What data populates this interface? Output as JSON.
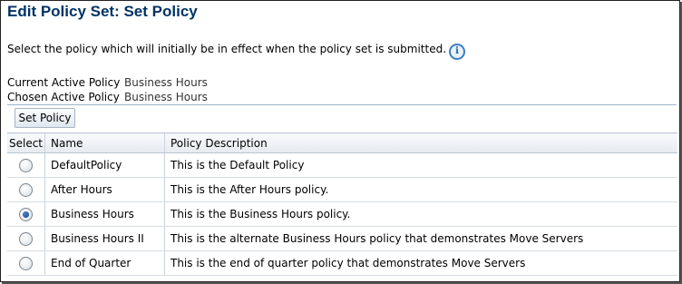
{
  "page": {
    "title": "Edit Policy Set: Set Policy",
    "instruction": "Select the policy which will initially be in effect when the policy set is submitted."
  },
  "status": {
    "current_label": "Current Active Policy",
    "current_value": "Business Hours",
    "chosen_label": "Chosen Active Policy",
    "chosen_value": "Business Hours"
  },
  "toolbar": {
    "set_policy_label": "Set Policy"
  },
  "table": {
    "headers": {
      "select": "Select",
      "name": "Name",
      "description": "Policy Description"
    },
    "rows": [
      {
        "name": "DefaultPolicy",
        "description": "This is the Default Policy",
        "selected": false
      },
      {
        "name": "After Hours",
        "description": "This is the After Hours policy.",
        "selected": false
      },
      {
        "name": "Business Hours",
        "description": "This is the Business Hours policy.",
        "selected": true
      },
      {
        "name": "Business Hours II",
        "description": "This is the alternate Business Hours policy that demonstrates Move Servers",
        "selected": false
      },
      {
        "name": "End of Quarter",
        "description": "This is the end of quarter policy that demonstrates Move Servers",
        "selected": false
      }
    ]
  },
  "icons": {
    "info": "info-icon"
  },
  "colors": {
    "title": "#003366",
    "accent": "#3b7fc4"
  }
}
